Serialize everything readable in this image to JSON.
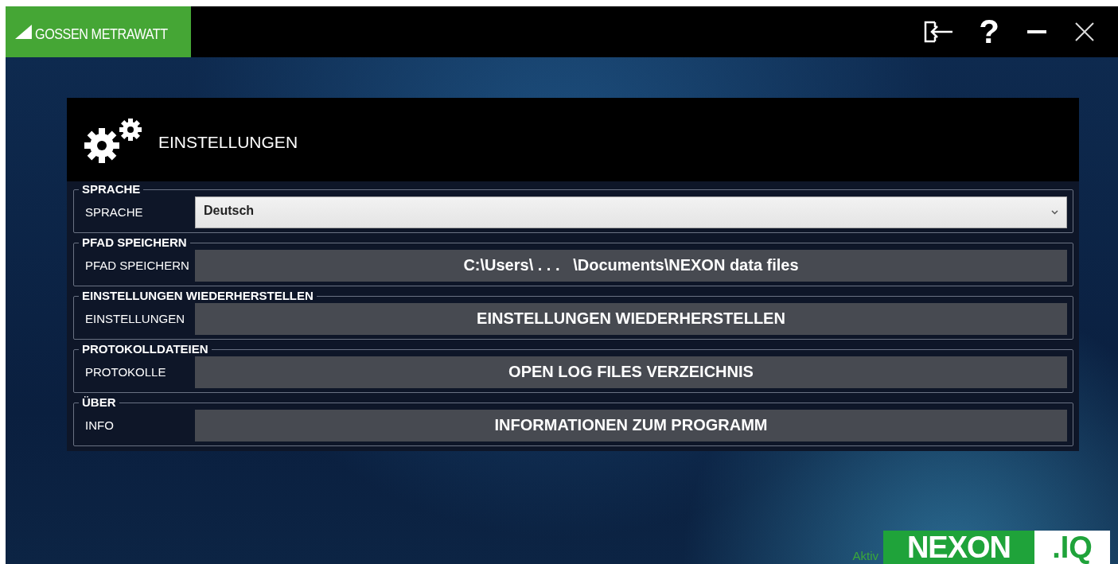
{
  "brand": {
    "name": "GOSSEN METRAWATT"
  },
  "window_controls": [
    {
      "kind": "logout"
    },
    {
      "kind": "help",
      "label": "?"
    },
    {
      "kind": "minimize"
    },
    {
      "kind": "close"
    }
  ],
  "panel": {
    "title": "EINSTELLUNGEN"
  },
  "sections": [
    {
      "legend": "SPRACHE",
      "label": "SPRACHE",
      "kind": "dropdown",
      "value": "Deutsch"
    },
    {
      "legend": "PFAD SPEICHERN",
      "label": "PFAD SPEICHERN",
      "kind": "button",
      "value": "C:\\Users\\ . . .   \\Documents\\NEXON data files"
    },
    {
      "legend": "EINSTELLUNGEN WIEDERHERSTELLEN",
      "label": "EINSTELLUNGEN",
      "kind": "button",
      "value": "EINSTELLUNGEN WIEDERHERSTELLEN"
    },
    {
      "legend": "PROTOKOLLDATEIEN",
      "label": "PROTOKOLLE",
      "kind": "button",
      "value": "OPEN LOG FILES VERZEICHNIS"
    },
    {
      "legend": "ÜBER",
      "label": "INFO",
      "kind": "button",
      "value": "INFORMATIONEN ZUM PROGRAMM"
    }
  ],
  "footer": {
    "status": "Aktiv",
    "logo_main": "NEXON",
    "logo_suffix": ".IQ"
  }
}
